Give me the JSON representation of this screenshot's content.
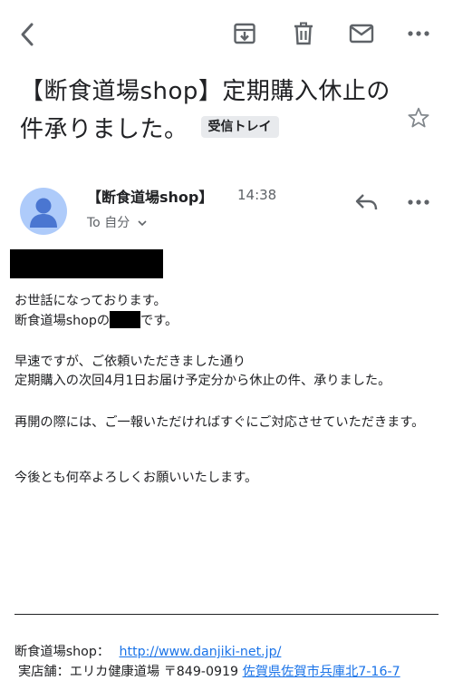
{
  "toolbar": {
    "back_icon": "chevron-left-icon",
    "archive_icon": "archive-icon",
    "delete_icon": "trash-icon",
    "mark_unread_icon": "mail-icon",
    "more_icon": "more-horizontal-icon"
  },
  "email": {
    "subject": "【断食道場shop】定期購入休止の件承りました。",
    "label_chip": "受信トレイ",
    "sender": "【断食道場shop】",
    "time": "14:38",
    "to_line": "To 自分",
    "body": {
      "greeting": "お世話になっております。",
      "intro_prefix": "断食道場shopの",
      "intro_suffix": "です。",
      "para2_line1": "早速ですが、ご依頼いただきました通り",
      "para2_line2": "定期購入の次回4月1日お届け予定分から休止の件、承りました。",
      "para3": "再開の際には、ご一報いただければすぐにご対応させていただきます。",
      "para4": "今後とも何卒よろしくお願いいたします。"
    },
    "signature": {
      "shop_label": "断食道場shop：",
      "shop_url": "http://www.danjiki-net.jp/",
      "store_label": "実店舗：エリカ健康道場 〒849-0919",
      "address": "佐賀県佐賀市兵庫北7-16-7"
    }
  },
  "colors": {
    "link": "#1a73e8",
    "chip_bg": "#e8eaed",
    "avatar_bg": "#aecbfa",
    "avatar_fg": "#4a76d1",
    "icon": "#5f6368"
  }
}
